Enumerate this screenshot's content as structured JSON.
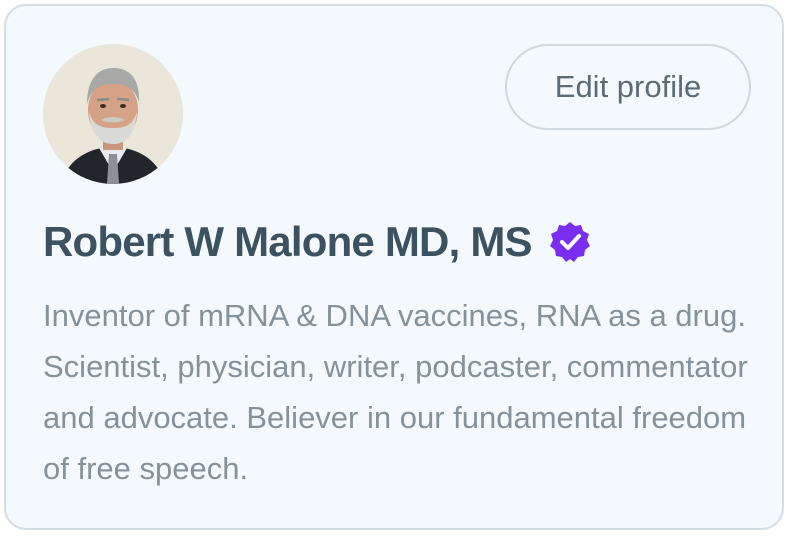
{
  "profile": {
    "name": "Robert W Malone MD, MS",
    "bio": "Inventor of mRNA & DNA vaccines, RNA as a drug. Scientist, physician, writer, podcaster, commentator and advocate. Believer in our fundamental freedom of free speech.",
    "verified_icon": "verified-badge-icon",
    "avatar_icon": "profile-photo"
  },
  "actions": {
    "edit_profile_label": "Edit profile"
  },
  "colors": {
    "card_background": "#f3f9fc",
    "card_border": "#d3dde3",
    "name_text": "#3d5261",
    "bio_text": "#86929b",
    "verified_badge": "#7a2ff0"
  }
}
